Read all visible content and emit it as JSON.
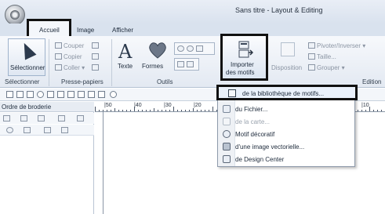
{
  "window": {
    "title": "Sans titre - Layout & Editing"
  },
  "tabs": [
    "Accueil",
    "Image",
    "Afficher"
  ],
  "ribbon": {
    "selection": {
      "button": "Sélectionner",
      "group": "Sélectionner"
    },
    "clipboard": {
      "cut": "Couper",
      "copy": "Copier",
      "paste": "Coller",
      "group": "Presse-papiers"
    },
    "tools": {
      "text": "Texte",
      "shapes": "Formes",
      "group": "Outils"
    },
    "import": {
      "label_line1": "Importer",
      "label_line2": "des motifs"
    },
    "layout": {
      "disposition": "Disposition",
      "rotate": "Pivoter/Inverser",
      "size": "Taille...",
      "group_btn": "Grouper",
      "group": "Edition"
    }
  },
  "left_panel": {
    "title": "Ordre de broderie"
  },
  "ruler": {
    "marks": [
      "|50",
      "|40",
      "|30",
      "|20",
      "|10"
    ],
    "right_mark": "|10"
  },
  "import_menu": {
    "items": [
      {
        "label": "de la bibliothèque de motifs...",
        "enabled": true,
        "icon": "library-icon"
      },
      {
        "label": "du Fichier...",
        "enabled": true,
        "icon": "file-icon"
      },
      {
        "label": "de la carte...",
        "enabled": false,
        "icon": "card-icon"
      },
      {
        "label": "Motif décoratif",
        "enabled": true,
        "icon": "decorative-pattern-icon"
      },
      {
        "label": "d'une image vectorielle...",
        "enabled": true,
        "icon": "vector-image-icon"
      },
      {
        "label": "de Design Center",
        "enabled": true,
        "icon": "design-center-icon"
      }
    ]
  }
}
